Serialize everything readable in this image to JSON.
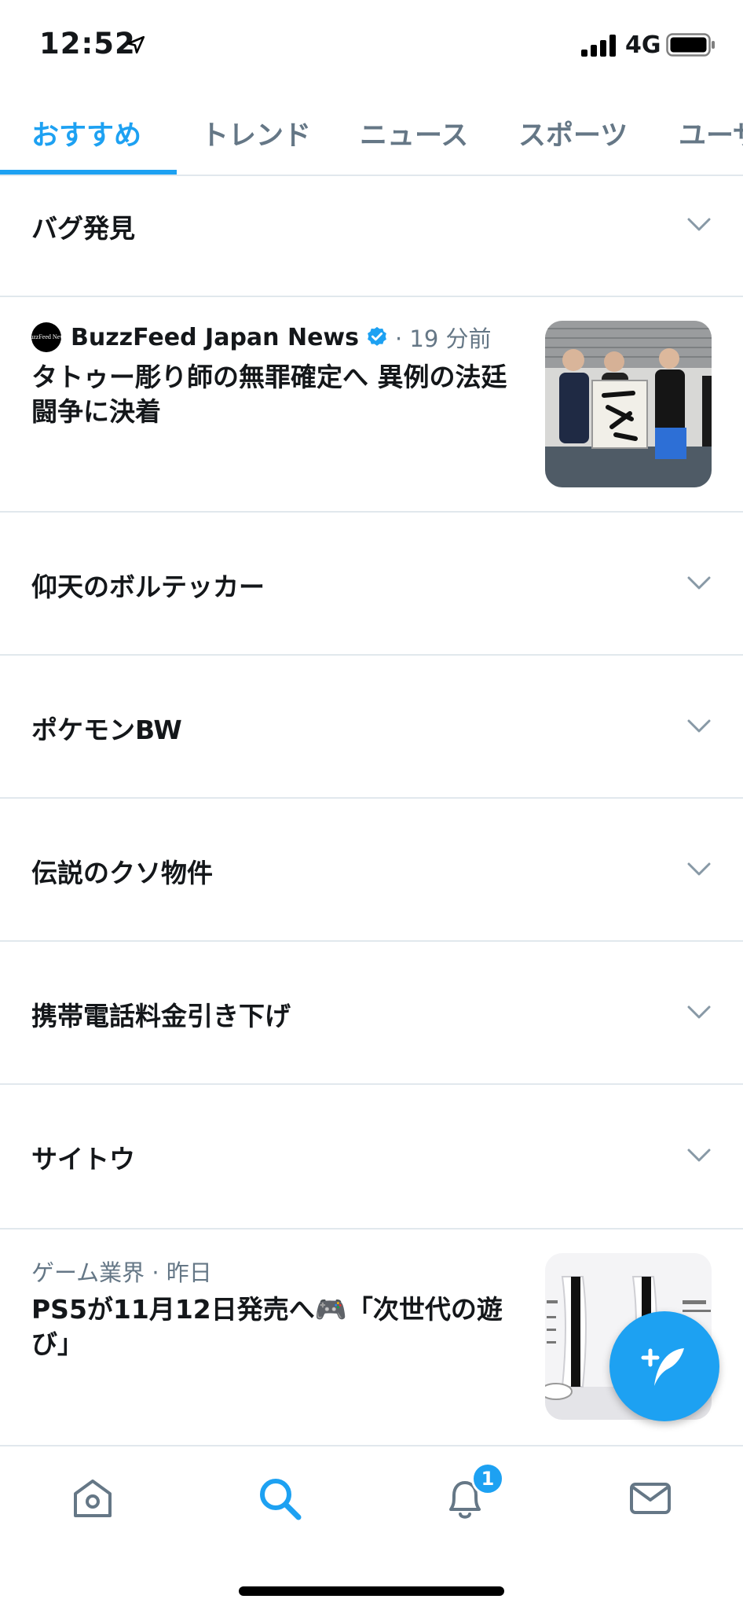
{
  "status_bar": {
    "time": "12:52",
    "network": "4G"
  },
  "tabs": [
    {
      "label": "おすすめ",
      "active": true
    },
    {
      "label": "トレンド",
      "active": false
    },
    {
      "label": "ニュース",
      "active": false
    },
    {
      "label": "スポーツ",
      "active": false
    },
    {
      "label": "ユーザー",
      "active": false
    }
  ],
  "rows": {
    "r1": "バグ発見",
    "r2": "仰天のボルテッカー",
    "r3": "ポケモンBW",
    "r4": "伝説のクソ物件",
    "r5": "携帯電話料金引き下げ",
    "r6": "サイトウ"
  },
  "news1": {
    "source_logo": "BuzzFeed News",
    "source": "BuzzFeed Japan News",
    "time": "· 19 分前",
    "title": "タトゥー彫り師の無罪確定へ 異例の法廷闘争に決着"
  },
  "news2": {
    "meta": "ゲーム業界 · 昨日",
    "title": "PS5が11月12日発売へ🎮「次世代の遊び」"
  },
  "bottom_nav": {
    "notification_count": "1"
  },
  "colors": {
    "accent": "#1da1f2",
    "text": "#14171a",
    "muted": "#657786",
    "divider": "#e1e8ed"
  },
  "icons": [
    "location-arrow-icon",
    "signal-icon",
    "battery-icon",
    "chevron-down-icon",
    "verified-badge-icon",
    "compose-tweet-icon",
    "home-icon",
    "search-icon",
    "bell-icon",
    "mail-icon"
  ]
}
